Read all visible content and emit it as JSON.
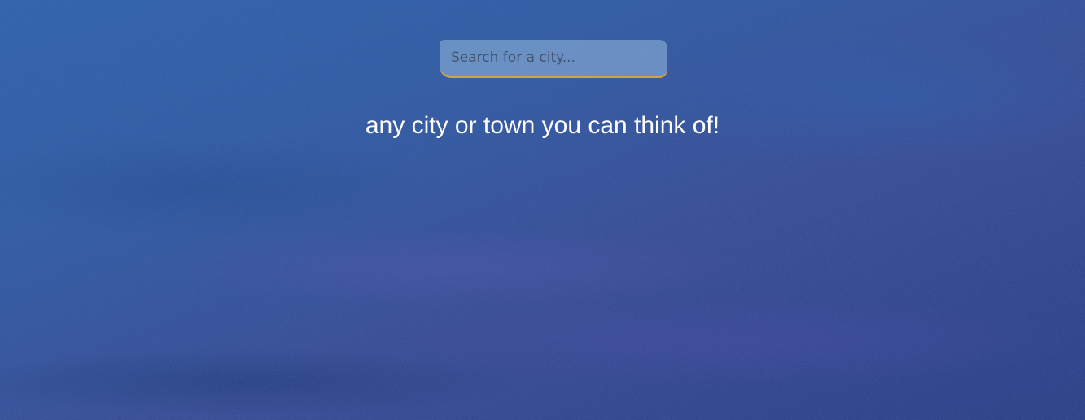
{
  "search": {
    "placeholder": "Search for a city...",
    "value": ""
  },
  "tagline": "any city or town you can think of!",
  "colors": {
    "accent_underline": "#d8a23a",
    "background_sky": "#2b4d93",
    "tagline_text": "#ffffff"
  },
  "icons": []
}
